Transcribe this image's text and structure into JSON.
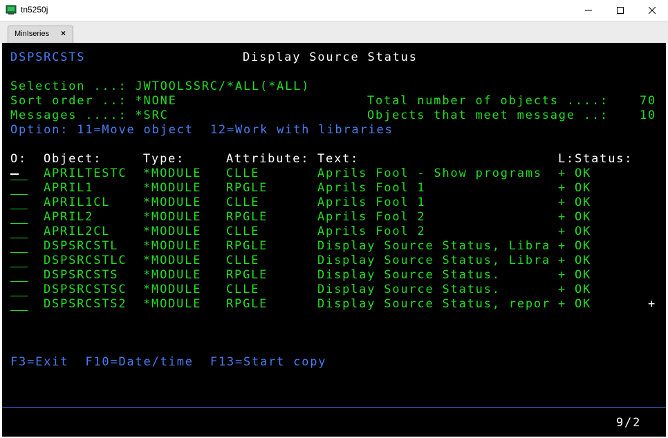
{
  "window": {
    "title": "tn5250j"
  },
  "tab": {
    "label": "MinIseries",
    "close": "×"
  },
  "screen": {
    "program": "DSPSRCSTS",
    "title": "Display Source Status",
    "selection": "Selection ...: JWTOOLSSRC/*ALL(*ALL)",
    "sort_order": "Sort order ..: *NONE",
    "messages": "Messages ....: *SRC",
    "total_label": "Total number of objects ....:",
    "total_value": "70",
    "meet_label": "Objects that meet message ..:",
    "meet_value": "10",
    "options": "Option: 11=Move object  12=Work with libraries",
    "headers": {
      "o": "O:",
      "object": "Object:",
      "type": "Type:",
      "attribute": "Attribute:",
      "text": "Text:",
      "ls": "L:Status:"
    },
    "rows": [
      {
        "object": "APRILTESTC",
        "type": "*MODULE",
        "attribute": "CLLE",
        "text": "Aprils Fool - Show programs",
        "l": "+",
        "status": "OK"
      },
      {
        "object": "APRIL1",
        "type": "*MODULE",
        "attribute": "RPGLE",
        "text": "Aprils Fool 1",
        "l": "+",
        "status": "OK"
      },
      {
        "object": "APRIL1CL",
        "type": "*MODULE",
        "attribute": "CLLE",
        "text": "Aprils Fool 1",
        "l": "+",
        "status": "OK"
      },
      {
        "object": "APRIL2",
        "type": "*MODULE",
        "attribute": "RPGLE",
        "text": "Aprils Fool 2",
        "l": "+",
        "status": "OK"
      },
      {
        "object": "APRIL2CL",
        "type": "*MODULE",
        "attribute": "CLLE",
        "text": "Aprils Fool 2",
        "l": "+",
        "status": "OK"
      },
      {
        "object": "DSPSRCSTL",
        "type": "*MODULE",
        "attribute": "RPGLE",
        "text": "Display Source Status, Libra",
        "l": "+",
        "status": "OK"
      },
      {
        "object": "DSPSRCSTLC",
        "type": "*MODULE",
        "attribute": "CLLE",
        "text": "Display Source Status, Libra",
        "l": "+",
        "status": "OK"
      },
      {
        "object": "DSPSRCSTS",
        "type": "*MODULE",
        "attribute": "RPGLE",
        "text": "Display Source Status.",
        "l": "+",
        "status": "OK"
      },
      {
        "object": "DSPSRCSTSC",
        "type": "*MODULE",
        "attribute": "CLLE",
        "text": "Display Source Status.",
        "l": "+",
        "status": "OK"
      },
      {
        "object": "DSPSRCSTS2",
        "type": "*MODULE",
        "attribute": "RPGLE",
        "text": "Display Source Status, repor",
        "l": "+",
        "status": "OK"
      }
    ],
    "more_indicator": "+",
    "function_keys": "F3=Exit  F10=Date/time  F13=Start copy",
    "cursor_position": "9/2"
  }
}
